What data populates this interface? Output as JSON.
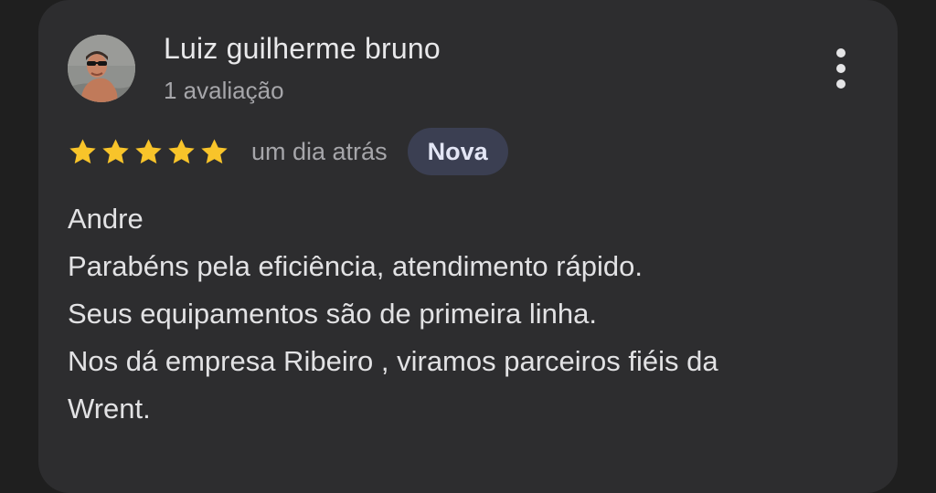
{
  "review": {
    "author_name": "Luiz guilherme bruno",
    "author_review_count": "1 avaliação",
    "rating": 5,
    "rating_max": 5,
    "date": "um dia atrás",
    "badge": "Nova",
    "text_lines": [
      "Andre",
      "Parabéns pela eficiência, atendimento rápido.",
      "Seus equipamentos são de primeira linha.",
      "Nos dá empresa Ribeiro , viramos parceiros fiéis da",
      "Wrent."
    ]
  },
  "icons": {
    "avatar": "avatar-photo",
    "more": "more-vertical-icon",
    "star": "star-icon"
  },
  "colors": {
    "background": "#1f1f1f",
    "card": "#2d2d2f",
    "star": "#f8c42a",
    "badge_background": "#3b3f52",
    "primary_text": "#e8e8ea",
    "secondary_text": "#a6a6aa"
  }
}
